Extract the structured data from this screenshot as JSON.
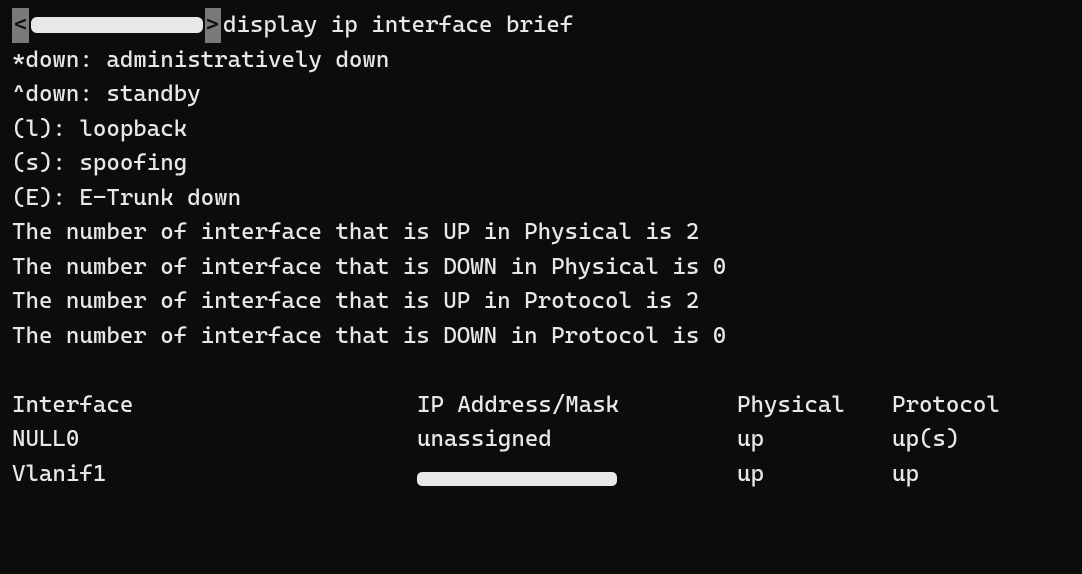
{
  "prompt": {
    "angle_open": "<",
    "angle_close": ">",
    "command": "display ip interface brief"
  },
  "legend": [
    "*down: administratively down",
    "^down: standby",
    "(l): loopback",
    "(s): spoofing",
    "(E): E-Trunk down"
  ],
  "counts": [
    "The number of interface that is UP in Physical is 2",
    "The number of interface that is DOWN in Physical is 0",
    "The number of interface that is UP in Protocol is 2",
    "The number of interface that is DOWN in Protocol is 0"
  ],
  "table": {
    "headers": [
      "Interface",
      "IP Address/Mask",
      "Physical",
      "Protocol"
    ],
    "rows": [
      {
        "interface": "NULL0",
        "ip": "unassigned",
        "physical": "up",
        "protocol": "up(s)"
      },
      {
        "interface": "Vlanif1",
        "ip": "",
        "physical": "up",
        "protocol": "up"
      }
    ]
  }
}
